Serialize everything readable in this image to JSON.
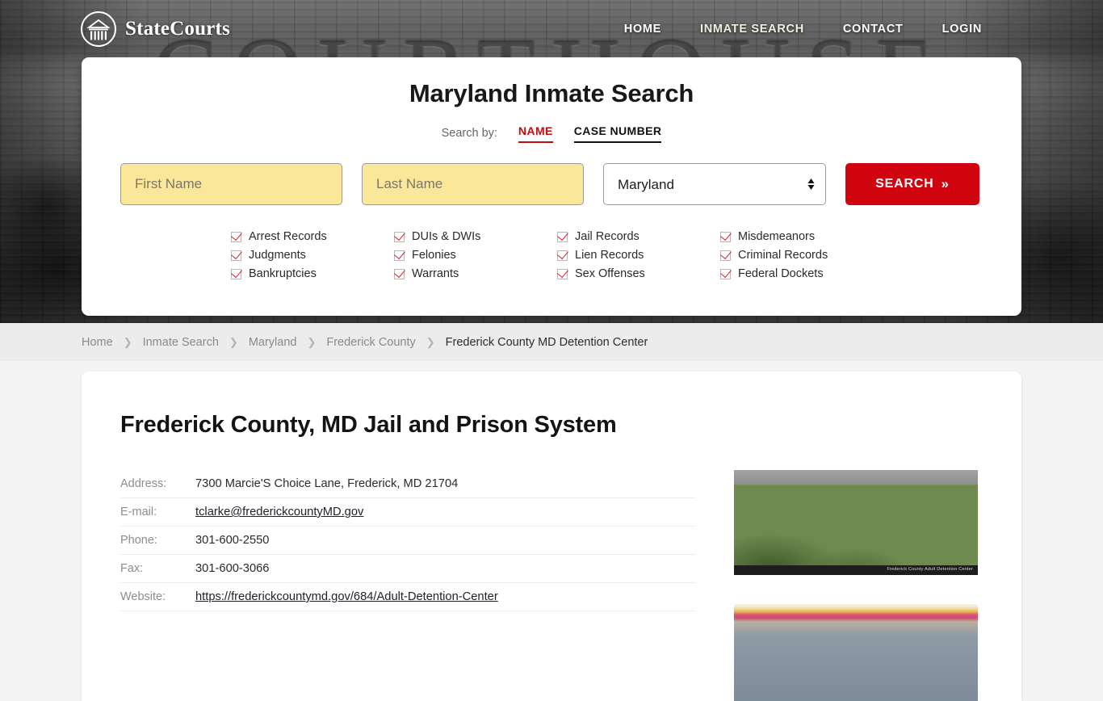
{
  "header": {
    "brand_name": "StateCourts",
    "brand_icon": "courthouse-circle-icon",
    "background_word": "COURTHOUSE",
    "nav": [
      {
        "label": "HOME",
        "active": false
      },
      {
        "label": "INMATE SEARCH",
        "active": true
      },
      {
        "label": "CONTACT",
        "active": false
      },
      {
        "label": "LOGIN",
        "active": false
      }
    ]
  },
  "search_card": {
    "title": "Maryland Inmate Search",
    "search_by_label": "Search by:",
    "tabs": [
      {
        "label": "NAME",
        "active": true,
        "color": "#c30c10"
      },
      {
        "label": "CASE NUMBER",
        "active": false,
        "color": "#111111"
      }
    ],
    "first_name": {
      "placeholder": "First Name",
      "value": ""
    },
    "last_name": {
      "placeholder": "Last Name",
      "value": ""
    },
    "state_select": {
      "value": "Maryland",
      "options": [
        "Maryland"
      ]
    },
    "search_button": {
      "label": "SEARCH",
      "chevron": "»",
      "color": "#d00510"
    },
    "record_types": [
      "Arrest Records",
      "DUIs & DWIs",
      "Jail Records",
      "Misdemeanors",
      "Judgments",
      "Felonies",
      "Lien Records",
      "Criminal Records",
      "Bankruptcies",
      "Warrants",
      "Sex Offenses",
      "Federal Dockets"
    ]
  },
  "breadcrumb": {
    "separator": "❯",
    "items": [
      {
        "label": "Home",
        "current": false
      },
      {
        "label": "Inmate Search",
        "current": false
      },
      {
        "label": "Maryland",
        "current": false
      },
      {
        "label": "Frederick County",
        "current": false
      },
      {
        "label": "Frederick County MD Detention Center",
        "current": true
      }
    ]
  },
  "content": {
    "page_title": "Frederick County, MD Jail and Prison System",
    "details": [
      {
        "label": "Address:",
        "value": "7300 Marcie'S Choice Lane, Frederick, MD 21704",
        "link": false
      },
      {
        "label": "E-mail:",
        "value": "tclarke@frederickcountyMD.gov",
        "link": true
      },
      {
        "label": "Phone:",
        "value": "301-600-2550",
        "link": false
      },
      {
        "label": "Fax:",
        "value": "301-600-3066",
        "link": false
      },
      {
        "label": "Website:",
        "value": "https://frederickcountymd.gov/684/Adult-Detention-Center",
        "link": true
      }
    ],
    "figure_caption": "Frederick County Adult Detention Center"
  }
}
